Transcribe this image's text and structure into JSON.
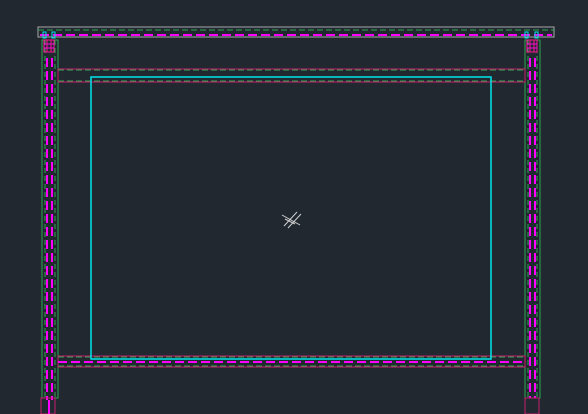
{
  "canvas": {
    "background": "#212830"
  },
  "layer_colors": {
    "frame": "#ff00ff",
    "detail": "#ff1493",
    "bead": "#c81e6e",
    "glass_edge": "#00e5ee",
    "hidden": "#2fa84f",
    "outline": "#a8a8a8",
    "marker": "#cfcfcf"
  },
  "drawing": {
    "description_icon": "cad-cursor-crosshair-icon"
  }
}
